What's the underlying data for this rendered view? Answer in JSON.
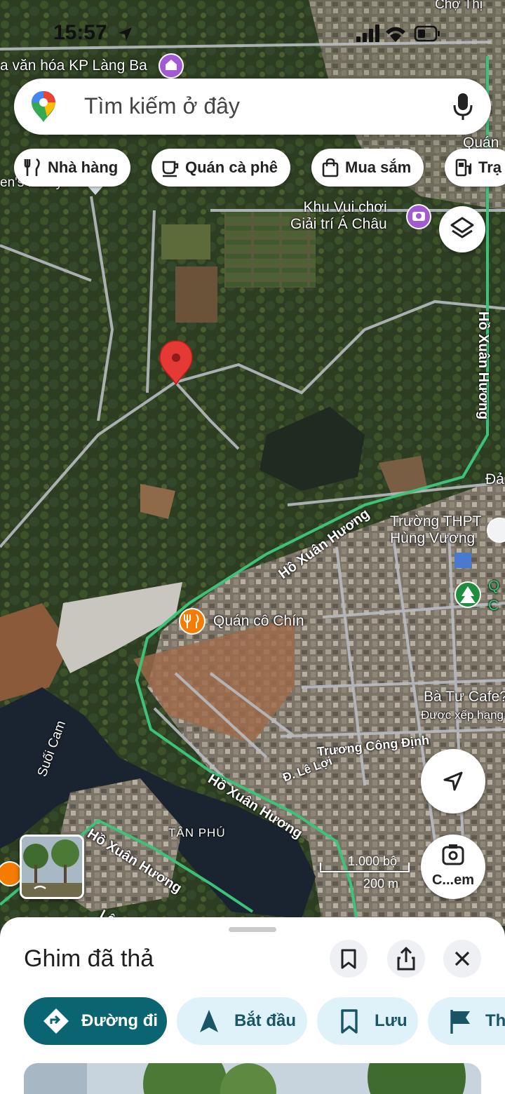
{
  "status_bar": {
    "time": "15:57"
  },
  "search": {
    "placeholder": "Tìm kiếm ở đây"
  },
  "chips": [
    {
      "label": "Nhà hàng",
      "icon": "fork-knife-icon"
    },
    {
      "label": "Quán cà phê",
      "icon": "coffee-cup-icon"
    },
    {
      "label": "Mua sắm",
      "icon": "shopping-bag-icon"
    },
    {
      "label": "Trạ",
      "icon": "gas-station-icon"
    }
  ],
  "map": {
    "places": {
      "culture_house": "a văn hóa KP Làng Ba",
      "amusement": "Khu Vui chơi\nGiải trí Á Châu",
      "school": "Trường THPT\nHùng Vương",
      "restaurant": "Quán cô Chín",
      "cafe": "Bà Tư Cafe?",
      "cafe_sub": "Được xếp hạng",
      "family": "en's family",
      "top_right": "Quán",
      "top_right2": "Chợ Thị",
      "park": "Q\nC",
      "da": "Đả"
    },
    "roads": {
      "ho_xuan_huong_1": "Hồ Xuân Hương",
      "ho_xuan_huong_2": "Hồ Xuân Hương",
      "ho_xuan_huong_3": "Hồ Xuân Hương",
      "ho_xuan_huong_4": "Hồ Xuân Hương",
      "truong_cong_dinh": "Trương Công Định",
      "le_loi": "Đ. Lê Lợi",
      "le_duan": "Lê Duẩ",
      "suoi_cam": "Suối Cam",
      "tan_phu": "TÂN PHÚ"
    },
    "scale": {
      "imperial": "1.000 bộ",
      "metric": "200 m"
    },
    "camera_label": "C...em"
  },
  "sheet": {
    "title": "Ghim đã thả",
    "actions": [
      {
        "label": "Đường đi",
        "icon": "directions-icon"
      },
      {
        "label": "Bắt đầu",
        "icon": "navigation-arrow-icon"
      },
      {
        "label": "Lưu",
        "icon": "bookmark-icon"
      },
      {
        "label": "Thê",
        "icon": "flag-icon"
      }
    ]
  },
  "colors": {
    "accent": "#0b6471",
    "pin": "#e53935",
    "poi_purple": "#a35bd3",
    "poi_orange": "#f57c00",
    "road_green": "#3cc37a"
  }
}
